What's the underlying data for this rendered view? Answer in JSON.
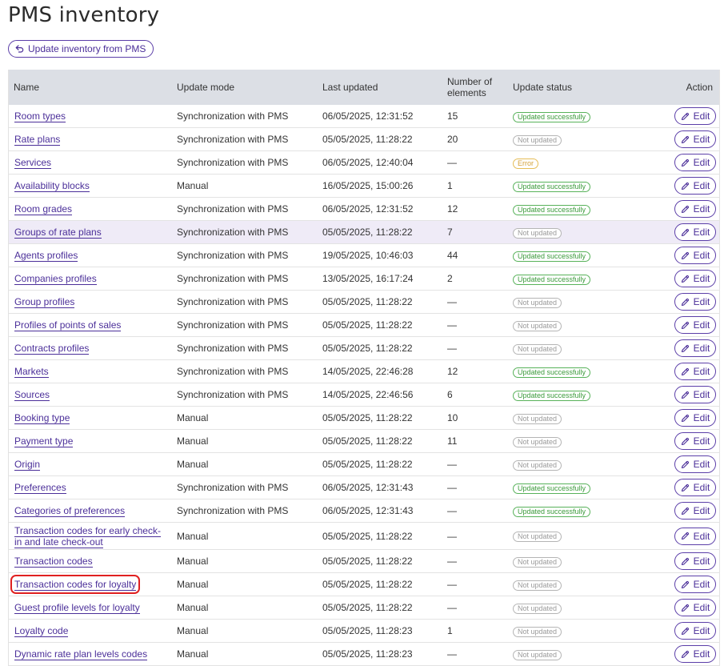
{
  "page": {
    "title": "PMS inventory",
    "update_button_label": "Update inventory from PMS"
  },
  "colors": {
    "accent": "#4b2f99",
    "header_bg": "#dcdfe5",
    "highlight_row_bg": "#efebf7",
    "status_success": "#3a9a3a",
    "status_error": "#d4a23a",
    "status_muted": "#9a9a9a",
    "annotation_box": "#e02020"
  },
  "table": {
    "columns": {
      "name": "Name",
      "mode": "Update mode",
      "updated": "Last updated",
      "count_line1": "Number of",
      "count_line2": "elements",
      "status": "Update status",
      "action": "Action"
    },
    "edit_label": "Edit",
    "edit_icon": "pencil-icon",
    "rows": [
      {
        "name": "Room types",
        "mode": "Synchronization with PMS",
        "updated": "06/05/2025, 12:31:52",
        "count": "15",
        "status": "Updated successfully",
        "status_type": "success"
      },
      {
        "name": "Rate plans",
        "mode": "Synchronization with PMS",
        "updated": "05/05/2025, 11:28:22",
        "count": "20",
        "status": "Not updated",
        "status_type": "muted"
      },
      {
        "name": "Services",
        "mode": "Synchronization with PMS",
        "updated": "06/05/2025, 12:40:04",
        "count": "—",
        "status": "Error",
        "status_type": "error"
      },
      {
        "name": "Availability blocks",
        "mode": "Manual",
        "updated": "16/05/2025, 15:00:26",
        "count": "1",
        "status": "Updated successfully",
        "status_type": "success"
      },
      {
        "name": "Room grades",
        "mode": "Synchronization with PMS",
        "updated": "06/05/2025, 12:31:52",
        "count": "12",
        "status": "Updated successfully",
        "status_type": "success"
      },
      {
        "name": "Groups of rate plans",
        "mode": "Synchronization with PMS",
        "updated": "05/05/2025, 11:28:22",
        "count": "7",
        "status": "Not updated",
        "status_type": "muted",
        "highlight": true
      },
      {
        "name": "Agents profiles",
        "mode": "Synchronization with PMS",
        "updated": "19/05/2025, 10:46:03",
        "count": "44",
        "status": "Updated successfully",
        "status_type": "success"
      },
      {
        "name": "Companies profiles",
        "mode": "Synchronization with PMS",
        "updated": "13/05/2025, 16:17:24",
        "count": "2",
        "status": "Updated successfully",
        "status_type": "success"
      },
      {
        "name": "Group profiles",
        "mode": "Synchronization with PMS",
        "updated": "05/05/2025, 11:28:22",
        "count": "—",
        "status": "Not updated",
        "status_type": "muted"
      },
      {
        "name": "Profiles of points of sales",
        "mode": "Synchronization with PMS",
        "updated": "05/05/2025, 11:28:22",
        "count": "—",
        "status": "Not updated",
        "status_type": "muted"
      },
      {
        "name": "Contracts profiles",
        "mode": "Synchronization with PMS",
        "updated": "05/05/2025, 11:28:22",
        "count": "—",
        "status": "Not updated",
        "status_type": "muted"
      },
      {
        "name": "Markets",
        "mode": "Synchronization with PMS",
        "updated": "14/05/2025, 22:46:28",
        "count": "12",
        "status": "Updated successfully",
        "status_type": "success"
      },
      {
        "name": "Sources",
        "mode": "Synchronization with PMS",
        "updated": "14/05/2025, 22:46:56",
        "count": "6",
        "status": "Updated successfully",
        "status_type": "success"
      },
      {
        "name": "Booking type",
        "mode": "Manual",
        "updated": "05/05/2025, 11:28:22",
        "count": "10",
        "status": "Not updated",
        "status_type": "muted"
      },
      {
        "name": "Payment type",
        "mode": "Manual",
        "updated": "05/05/2025, 11:28:22",
        "count": "11",
        "status": "Not updated",
        "status_type": "muted"
      },
      {
        "name": "Origin",
        "mode": "Manual",
        "updated": "05/05/2025, 11:28:22",
        "count": "—",
        "status": "Not updated",
        "status_type": "muted"
      },
      {
        "name": "Preferences",
        "mode": "Synchronization with PMS",
        "updated": "06/05/2025, 12:31:43",
        "count": "—",
        "status": "Updated successfully",
        "status_type": "success"
      },
      {
        "name": "Categories of preferences",
        "mode": "Synchronization with PMS",
        "updated": "06/05/2025, 12:31:43",
        "count": "—",
        "status": "Updated successfully",
        "status_type": "success"
      },
      {
        "name": "Transaction codes for early check-in and late check-out",
        "mode": "Manual",
        "updated": "05/05/2025, 11:28:22",
        "count": "—",
        "status": "Not updated",
        "status_type": "muted",
        "tall": true
      },
      {
        "name": "Transaction codes",
        "mode": "Manual",
        "updated": "05/05/2025, 11:28:22",
        "count": "—",
        "status": "Not updated",
        "status_type": "muted"
      },
      {
        "name": "Transaction codes for loyalty",
        "mode": "Manual",
        "updated": "05/05/2025, 11:28:22",
        "count": "—",
        "status": "Not updated",
        "status_type": "muted",
        "boxed": true
      },
      {
        "name": "Guest profile levels for loyalty",
        "mode": "Manual",
        "updated": "05/05/2025, 11:28:22",
        "count": "—",
        "status": "Not updated",
        "status_type": "muted"
      },
      {
        "name": "Loyalty code",
        "mode": "Manual",
        "updated": "05/05/2025, 11:28:23",
        "count": "1",
        "status": "Not updated",
        "status_type": "muted"
      },
      {
        "name": "Dynamic rate plan levels codes",
        "mode": "Manual",
        "updated": "05/05/2025, 11:28:23",
        "count": "—",
        "status": "Not updated",
        "status_type": "muted"
      }
    ]
  }
}
